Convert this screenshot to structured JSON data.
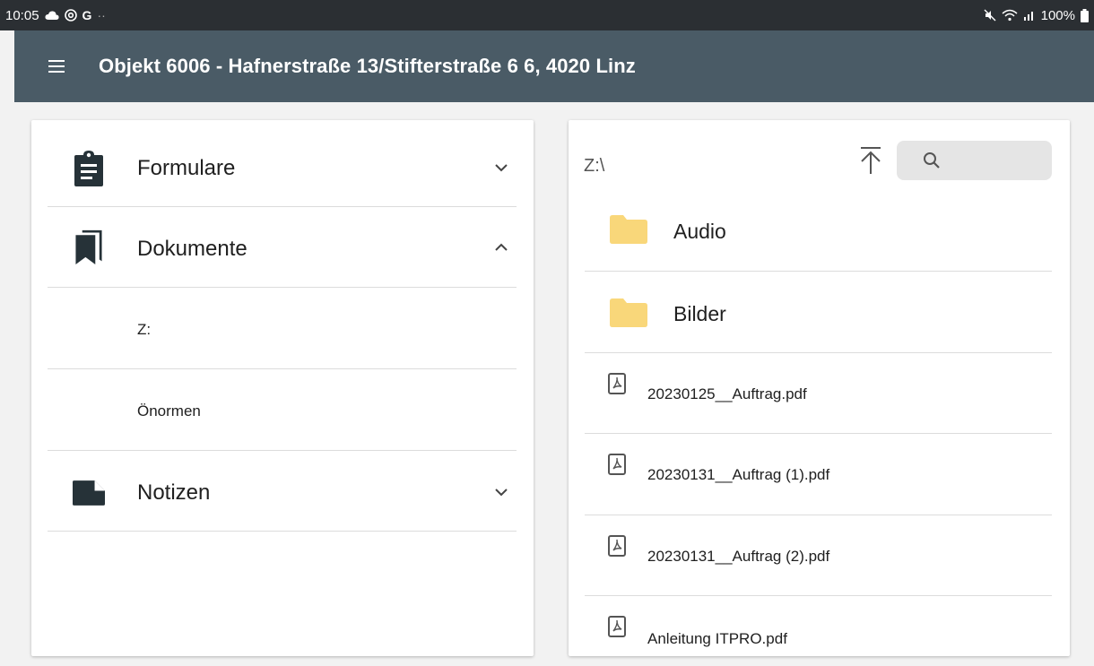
{
  "status_bar": {
    "time": "10:05",
    "left_icons": [
      "cloud-icon",
      "at-sign-icon",
      "google-g-icon",
      "more-dots-icon"
    ],
    "google_glyph": "G",
    "more_glyph": "··",
    "battery": "100%",
    "right_icons": [
      "mute-icon",
      "wifi-icon",
      "signal-icon",
      "battery-icon"
    ]
  },
  "app_bar": {
    "title": "Objekt 6006 - Hafnerstraße 13/Stifterstraße 6 6, 4020 Linz",
    "background": "#4a5b66"
  },
  "nav": {
    "sections": [
      {
        "label": "Formulare",
        "icon": "clipboard-icon",
        "expanded": false
      },
      {
        "label": "Dokumente",
        "icon": "bookmarks-icon",
        "expanded": true,
        "children": [
          {
            "label": "Z:"
          },
          {
            "label": "Önormen"
          }
        ]
      },
      {
        "label": "Notizen",
        "icon": "note-icon",
        "expanded": false
      }
    ]
  },
  "browser": {
    "path": "Z:\\",
    "search_placeholder": "",
    "folders": [
      {
        "name": "Audio",
        "icon": "folder-icon"
      },
      {
        "name": "Bilder",
        "icon": "folder-icon"
      }
    ],
    "files": [
      {
        "name": "20230125__Auftrag.pdf",
        "icon": "pdf-icon"
      },
      {
        "name": "20230131__Auftrag (1).pdf",
        "icon": "pdf-icon"
      },
      {
        "name": "20230131__Auftrag (2).pdf",
        "icon": "pdf-icon"
      },
      {
        "name": "Anleitung ITPRO.pdf",
        "icon": "pdf-icon"
      }
    ],
    "folder_color": "#f9d77a"
  }
}
